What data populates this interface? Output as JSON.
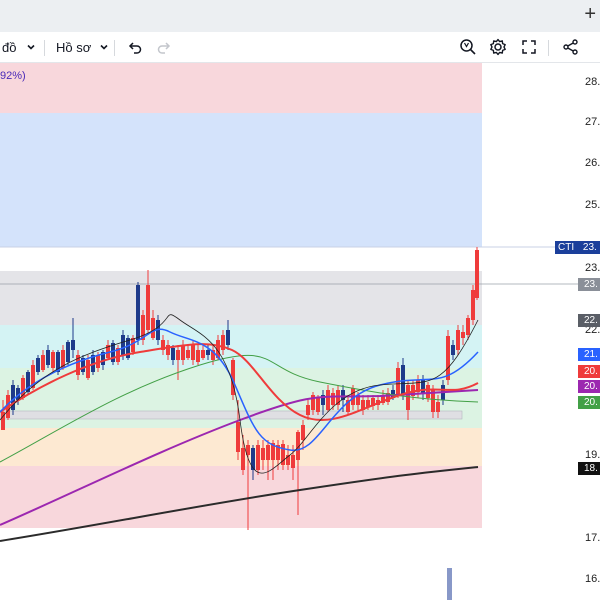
{
  "toolbar": {
    "chart_type_label": "đồ",
    "profile_label": "Hồ sơ",
    "icons": [
      "chevron-down-icon",
      "undo-icon",
      "redo-icon",
      "search-icon",
      "gear-icon",
      "fullscreen-icon",
      "share-icon",
      "plus-icon"
    ]
  },
  "chart": {
    "percent_label": "92%)",
    "price_axis": [
      "28.",
      "27.",
      "26.",
      "25.",
      "23.",
      "22.",
      "19.",
      "17.",
      "16."
    ],
    "price_tags": [
      {
        "label": "23.",
        "color": "#8a8f98"
      },
      {
        "label": "22.",
        "color": "#5a5e66"
      },
      {
        "label": "21.",
        "color": "#2962ff"
      },
      {
        "label": "20.",
        "color": "#ef3b3b"
      },
      {
        "label": "20.",
        "color": "#9c27b0"
      },
      {
        "label": "20.",
        "color": "#43a047"
      },
      {
        "label": "18.",
        "color": "#111111"
      }
    ],
    "current_tag": {
      "symbol": "CTI",
      "value": "23."
    },
    "colors": {
      "up": "#1e3a8a",
      "down": "#ef3b3b",
      "ma_fast": "#2962ff",
      "ma_mid": "#ef3b3b",
      "ma_slow": "#43a047",
      "ma_purple": "#9c27b0",
      "ma_long": "#2b2b2b"
    },
    "zones": [
      {
        "color": "#f8d7dc"
      },
      {
        "color": "#d4e3fb"
      },
      {
        "color": "#e4e4e8"
      },
      {
        "color": "#d4f3f4"
      },
      {
        "color": "#dcf3e3"
      },
      {
        "color": "#fde9d2"
      },
      {
        "color": "#f8d7dc"
      }
    ]
  }
}
